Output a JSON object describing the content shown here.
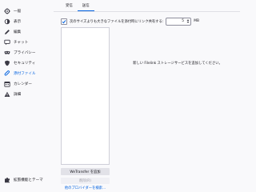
{
  "sidebar": {
    "items": [
      {
        "label": "一般",
        "icon": "gear-icon"
      },
      {
        "label": "表示",
        "icon": "display-icon"
      },
      {
        "label": "編集",
        "icon": "pencil-icon"
      },
      {
        "label": "チャット",
        "icon": "chat-icon"
      },
      {
        "label": "プライバシー",
        "icon": "mask-icon"
      },
      {
        "label": "セキュリティ",
        "icon": "shield-icon"
      },
      {
        "label": "添付ファイル",
        "icon": "paperclip-icon",
        "selected": true
      },
      {
        "label": "カレンダー",
        "icon": "calendar-icon"
      },
      {
        "label": "詳細",
        "icon": "warning-icon"
      }
    ],
    "footer": {
      "label": "拡張機能とテーマ",
      "icon": "puzzle-icon"
    }
  },
  "tabs": [
    {
      "label": "受信"
    },
    {
      "label": "送信",
      "selected": true
    }
  ],
  "offer": {
    "checked": true,
    "label": "次のサイズよりも大きなファイルを添付時にリンク共有する:",
    "size_value": "5",
    "unit": "MB"
  },
  "providers": {
    "empty_message": "新しい Filelink ストレージサービスを追加してください。",
    "add_button": "WeTransfer を追加",
    "remove_button": "削除(R)",
    "more_link": "他のプロバイダーを検索..."
  },
  "colors": {
    "accent": "#0061e0",
    "background": "#f9f9fb"
  }
}
